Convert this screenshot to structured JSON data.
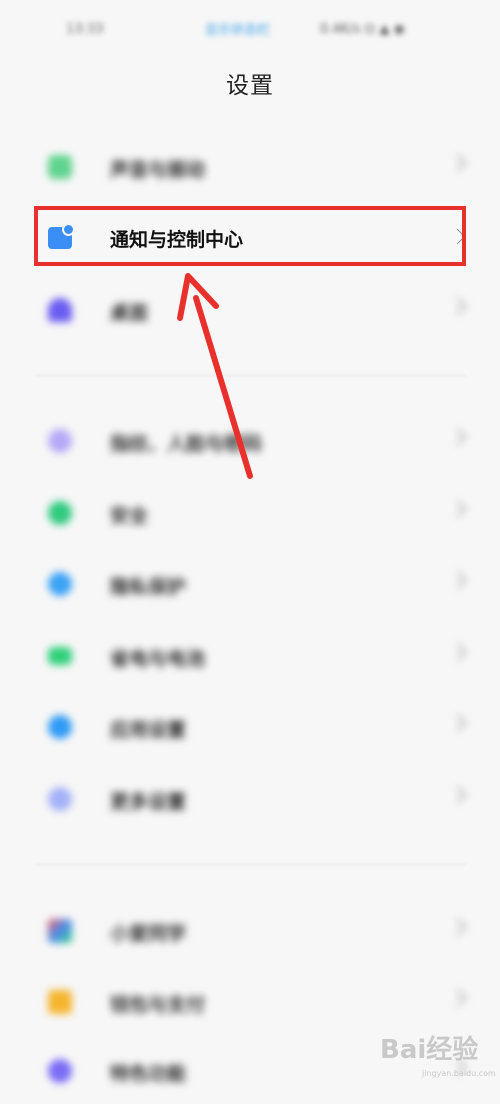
{
  "status_bar": {
    "time": "13:33",
    "center_text": "显示状态栏",
    "right_text": "0.4K/s ⊡ ▲ ◉"
  },
  "page": {
    "title": "设置"
  },
  "sections": [
    {
      "items": [
        {
          "label": "声音与振动",
          "icon": "speaker-icon",
          "color": "#5fd38d"
        },
        {
          "label": "通知与控制中心",
          "icon": "notification-icon",
          "color": "#3a8ef5"
        },
        {
          "label": "桌面",
          "icon": "home-icon",
          "color": "#6a5cf0"
        }
      ]
    },
    {
      "items": [
        {
          "label": "指纹、人脸与密码",
          "icon": "fingerprint-icon",
          "color": "#9d8cf5"
        },
        {
          "label": "安全",
          "icon": "shield-icon",
          "color": "#2fca7e"
        },
        {
          "label": "隐私保护",
          "icon": "privacy-icon",
          "color": "#3aa2f5"
        },
        {
          "label": "省电与电池",
          "icon": "battery-icon",
          "color": "#2fd07a"
        },
        {
          "label": "应用设置",
          "icon": "gear-icon",
          "color": "#2f9af5"
        },
        {
          "label": "更多设置",
          "icon": "more-icon",
          "color": "#8c9ef5"
        }
      ]
    },
    {
      "items": [
        {
          "label": "小爱同学",
          "icon": "assistant-icon",
          "color": "#4a8cf0"
        },
        {
          "label": "钱包与支付",
          "icon": "wallet-icon",
          "color": "#f5b52f"
        },
        {
          "label": "特色功能",
          "icon": "feature-icon",
          "color": "#7a6cf5"
        }
      ]
    }
  ],
  "annotation": {
    "box_color": "#e8302c",
    "arrow_color": "#e8302c"
  },
  "watermark": {
    "brand": "Bai经验",
    "sub": "jingyan.baidu.com"
  }
}
